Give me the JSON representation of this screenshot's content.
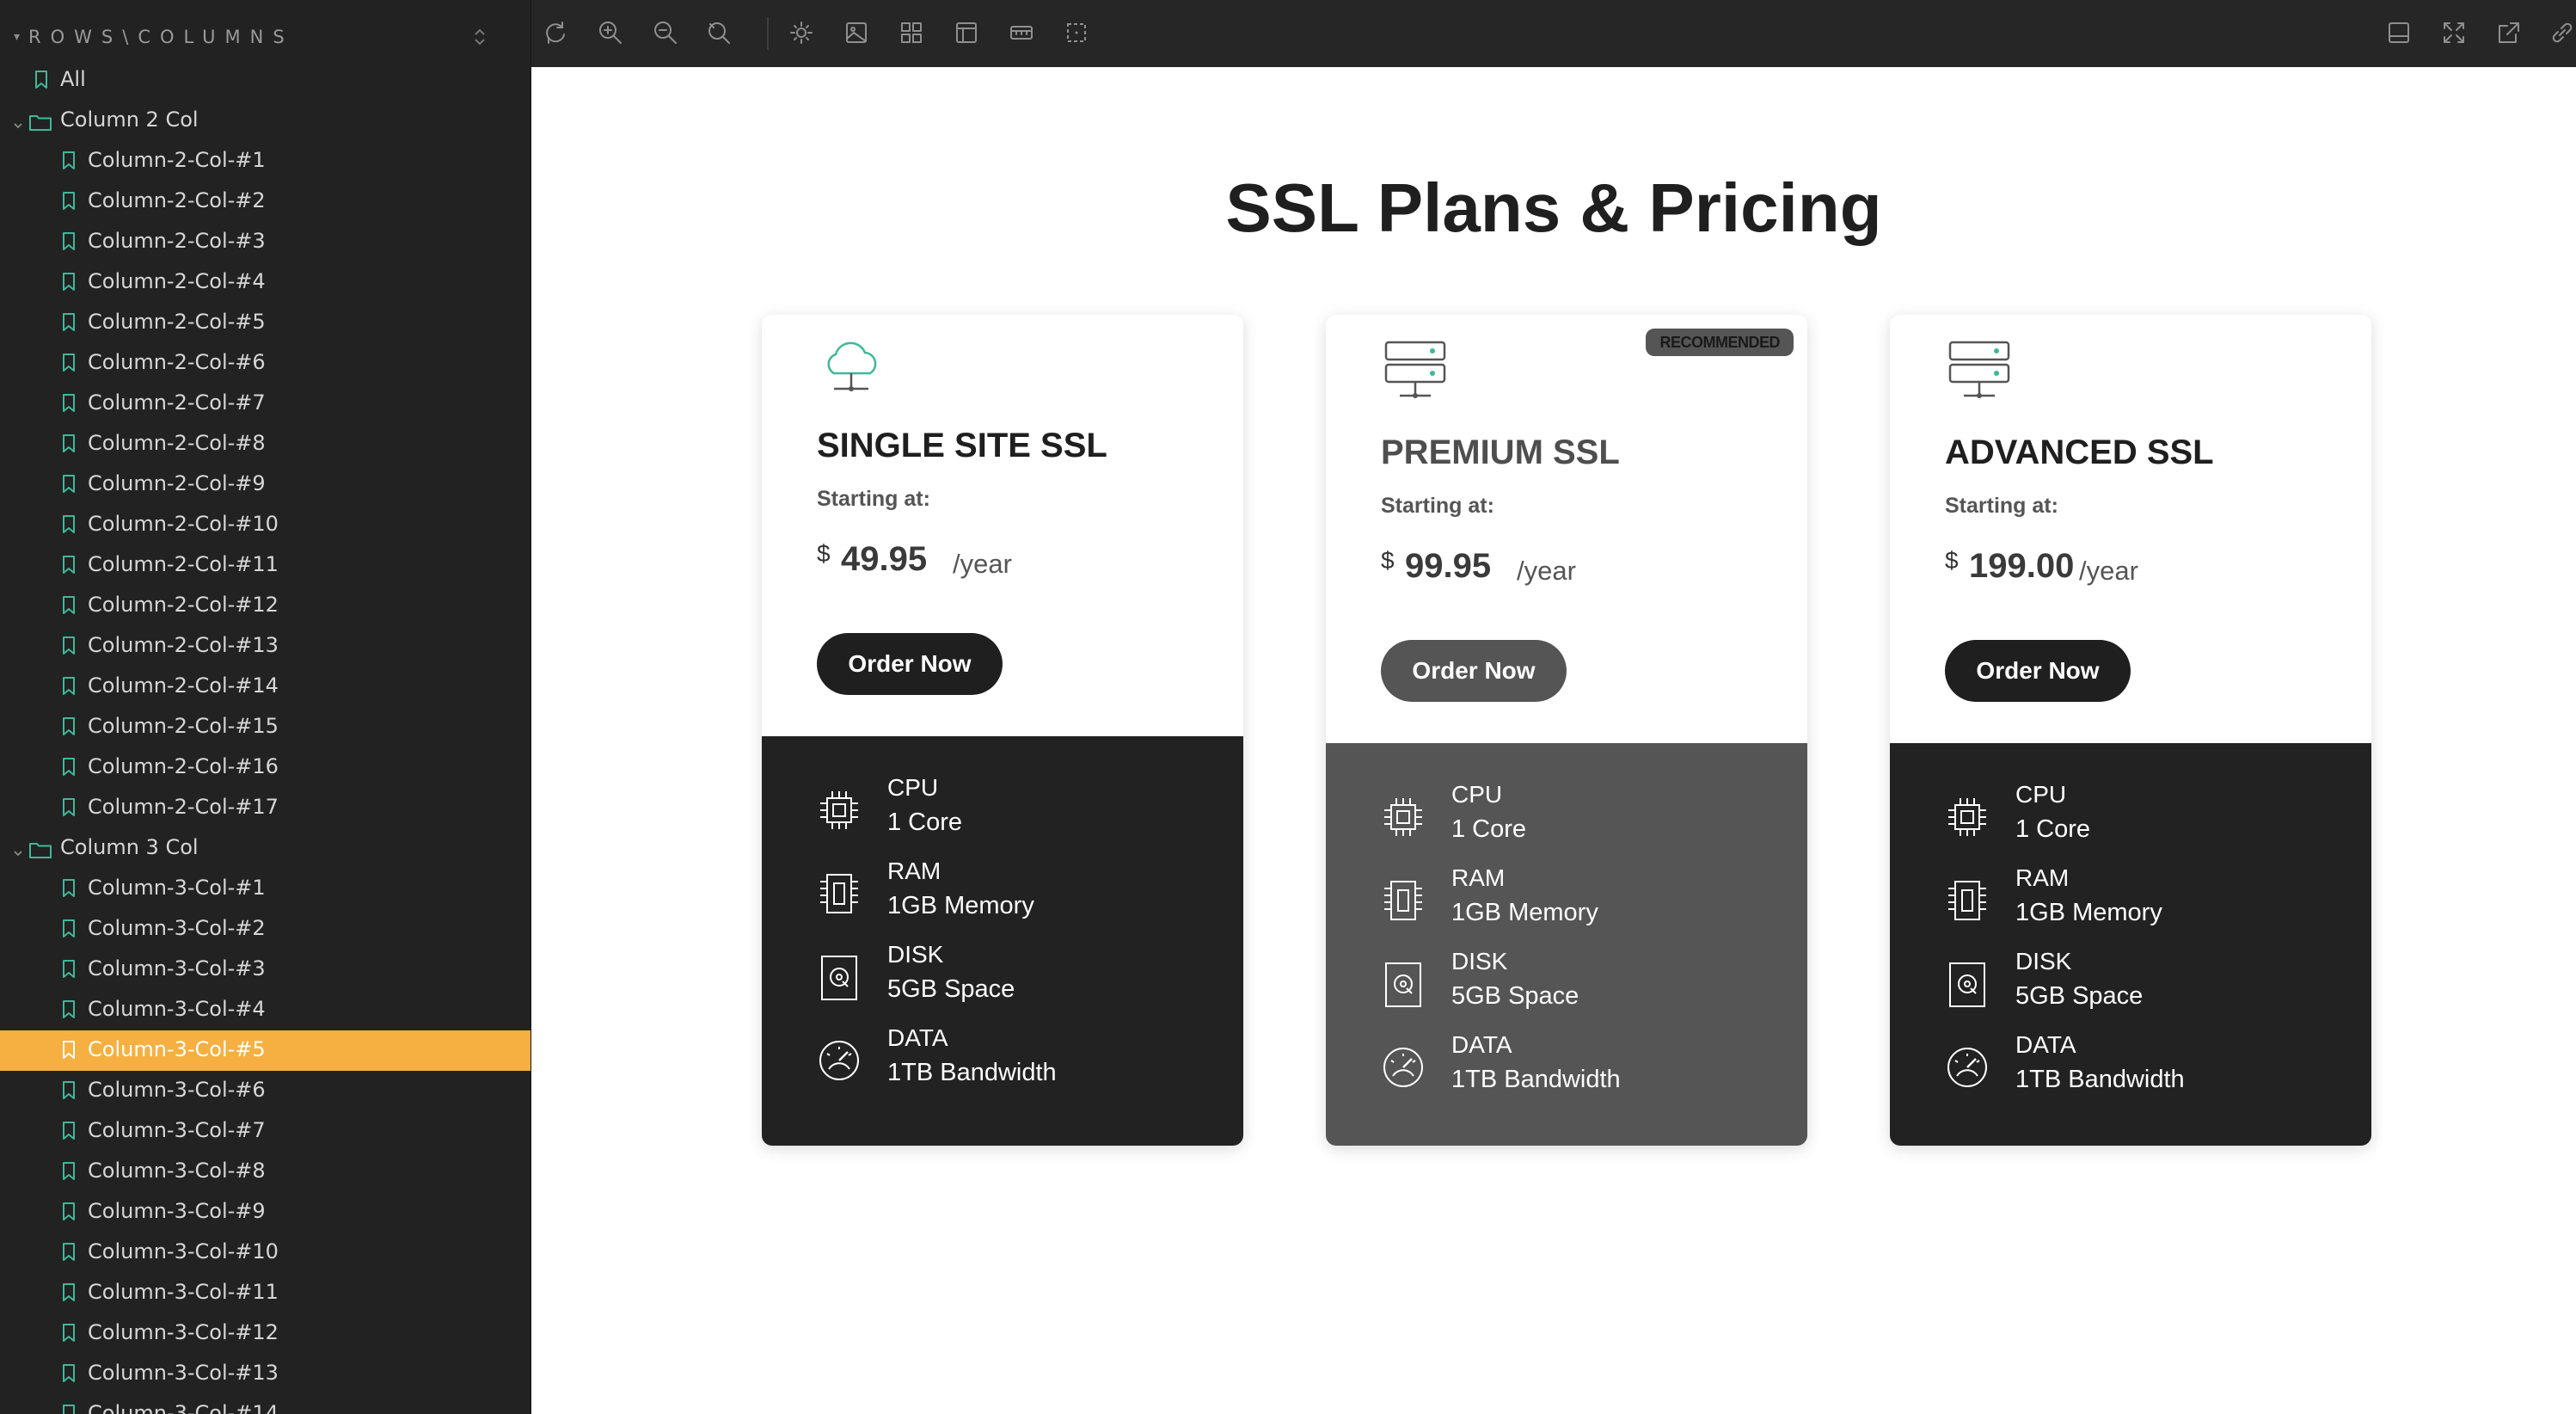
{
  "sidebar": {
    "title": "ROWS\\COLUMNS",
    "items": [
      {
        "label": "All",
        "type": "bookmark",
        "level": 0
      },
      {
        "label": "Column 2 Col",
        "type": "folder",
        "level": 0
      },
      {
        "label": "Column-2-Col-#1",
        "type": "bookmark",
        "level": 1
      },
      {
        "label": "Column-2-Col-#2",
        "type": "bookmark",
        "level": 1
      },
      {
        "label": "Column-2-Col-#3",
        "type": "bookmark",
        "level": 1
      },
      {
        "label": "Column-2-Col-#4",
        "type": "bookmark",
        "level": 1
      },
      {
        "label": "Column-2-Col-#5",
        "type": "bookmark",
        "level": 1
      },
      {
        "label": "Column-2-Col-#6",
        "type": "bookmark",
        "level": 1
      },
      {
        "label": "Column-2-Col-#7",
        "type": "bookmark",
        "level": 1
      },
      {
        "label": "Column-2-Col-#8",
        "type": "bookmark",
        "level": 1
      },
      {
        "label": "Column-2-Col-#9",
        "type": "bookmark",
        "level": 1
      },
      {
        "label": "Column-2-Col-#10",
        "type": "bookmark",
        "level": 1
      },
      {
        "label": "Column-2-Col-#11",
        "type": "bookmark",
        "level": 1
      },
      {
        "label": "Column-2-Col-#12",
        "type": "bookmark",
        "level": 1
      },
      {
        "label": "Column-2-Col-#13",
        "type": "bookmark",
        "level": 1
      },
      {
        "label": "Column-2-Col-#14",
        "type": "bookmark",
        "level": 1
      },
      {
        "label": "Column-2-Col-#15",
        "type": "bookmark",
        "level": 1
      },
      {
        "label": "Column-2-Col-#16",
        "type": "bookmark",
        "level": 1
      },
      {
        "label": "Column-2-Col-#17",
        "type": "bookmark",
        "level": 1
      },
      {
        "label": "Column 3 Col",
        "type": "folder",
        "level": 0
      },
      {
        "label": "Column-3-Col-#1",
        "type": "bookmark",
        "level": 1
      },
      {
        "label": "Column-3-Col-#2",
        "type": "bookmark",
        "level": 1
      },
      {
        "label": "Column-3-Col-#3",
        "type": "bookmark",
        "level": 1
      },
      {
        "label": "Column-3-Col-#4",
        "type": "bookmark",
        "level": 1
      },
      {
        "label": "Column-3-Col-#5",
        "type": "bookmark",
        "level": 1,
        "active": true
      },
      {
        "label": "Column-3-Col-#6",
        "type": "bookmark",
        "level": 1
      },
      {
        "label": "Column-3-Col-#7",
        "type": "bookmark",
        "level": 1
      },
      {
        "label": "Column-3-Col-#8",
        "type": "bookmark",
        "level": 1
      },
      {
        "label": "Column-3-Col-#9",
        "type": "bookmark",
        "level": 1
      },
      {
        "label": "Column-3-Col-#10",
        "type": "bookmark",
        "level": 1
      },
      {
        "label": "Column-3-Col-#11",
        "type": "bookmark",
        "level": 1
      },
      {
        "label": "Column-3-Col-#12",
        "type": "bookmark",
        "level": 1
      },
      {
        "label": "Column-3-Col-#13",
        "type": "bookmark",
        "level": 1
      },
      {
        "label": "Column-3-Col-#14",
        "type": "bookmark",
        "level": 1
      }
    ]
  },
  "toolbar": {
    "left_icons": [
      "refresh-icon",
      "zoom-in-icon",
      "zoom-out-icon",
      "reset-zoom-icon",
      "sun-icon",
      "image-icon",
      "grid-icon",
      "layers-icon",
      "ruler-icon",
      "select-icon"
    ],
    "right_icons": [
      "panel-icon",
      "fullscreen-icon",
      "external-link-icon",
      "link-icon"
    ]
  },
  "page": {
    "title": "SSL Plans & Pricing"
  },
  "plans": [
    {
      "name": "SINGLE SITE SSL",
      "starting_label": "Starting at:",
      "currency": "$",
      "price": "49.95",
      "period": "/year",
      "button": "Order Now",
      "icon": "cloud-icon",
      "recommended": false,
      "specs": [
        {
          "name": "CPU",
          "value": "1 Core",
          "icon": "cpu-icon"
        },
        {
          "name": "RAM",
          "value": "1GB Memory",
          "icon": "ram-icon"
        },
        {
          "name": "DISK",
          "value": "5GB Space",
          "icon": "disk-icon"
        },
        {
          "name": "DATA",
          "value": "1TB Bandwidth",
          "icon": "gauge-icon"
        }
      ]
    },
    {
      "name": "PREMIUM SSL",
      "starting_label": "Starting at:",
      "currency": "$",
      "price": "99.95",
      "period": "/year",
      "button": "Order Now",
      "icon": "server-icon",
      "recommended": true,
      "badge": "RECOMMENDED",
      "specs": [
        {
          "name": "CPU",
          "value": "1 Core",
          "icon": "cpu-icon"
        },
        {
          "name": "RAM",
          "value": "1GB Memory",
          "icon": "ram-icon"
        },
        {
          "name": "DISK",
          "value": "5GB Space",
          "icon": "disk-icon"
        },
        {
          "name": "DATA",
          "value": "1TB Bandwidth",
          "icon": "gauge-icon"
        }
      ]
    },
    {
      "name": "ADVANCED SSL",
      "starting_label": "Starting at:",
      "currency": "$",
      "price": "199.00",
      "period": "/year",
      "button": "Order Now",
      "icon": "server-icon",
      "recommended": false,
      "specs": [
        {
          "name": "CPU",
          "value": "1 Core",
          "icon": "cpu-icon"
        },
        {
          "name": "RAM",
          "value": "1GB Memory",
          "icon": "ram-icon"
        },
        {
          "name": "DISK",
          "value": "5GB Space",
          "icon": "disk-icon"
        },
        {
          "name": "DATA",
          "value": "1TB Bandwidth",
          "icon": "gauge-icon"
        }
      ]
    }
  ],
  "colors": {
    "sidebar_bg": "#222222",
    "toolbar_bg": "#262626",
    "accent": "#f5b041",
    "icon_teal": "#3fb89a",
    "dark_card": "#222222",
    "mid_card": "#555555"
  }
}
